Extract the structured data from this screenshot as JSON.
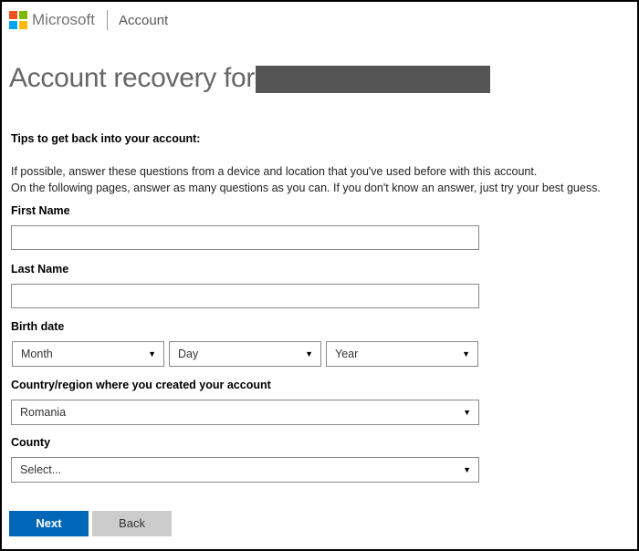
{
  "header": {
    "brand": "Microsoft",
    "section": "Account",
    "logo_colors": [
      "#f25022",
      "#7fba00",
      "#00a4ef",
      "#ffb900"
    ]
  },
  "title": "Account recovery for",
  "tips": {
    "heading": "Tips to get back into your account:",
    "line1": "If possible, answer these questions from a device and location that you've used before with this account.",
    "line2": "On the following pages, answer as many questions as you can. If you don't know an answer, just try your best guess."
  },
  "form": {
    "first_name": {
      "label": "First Name",
      "value": ""
    },
    "last_name": {
      "label": "Last Name",
      "value": ""
    },
    "birth_date": {
      "label": "Birth date",
      "month": "Month",
      "day": "Day",
      "year": "Year"
    },
    "country": {
      "label": "Country/region where you created your account",
      "value": "Romania"
    },
    "county": {
      "label": "County",
      "value": "Select..."
    }
  },
  "buttons": {
    "next": "Next",
    "back": "Back"
  },
  "colors": {
    "accent": "#0067b8"
  }
}
